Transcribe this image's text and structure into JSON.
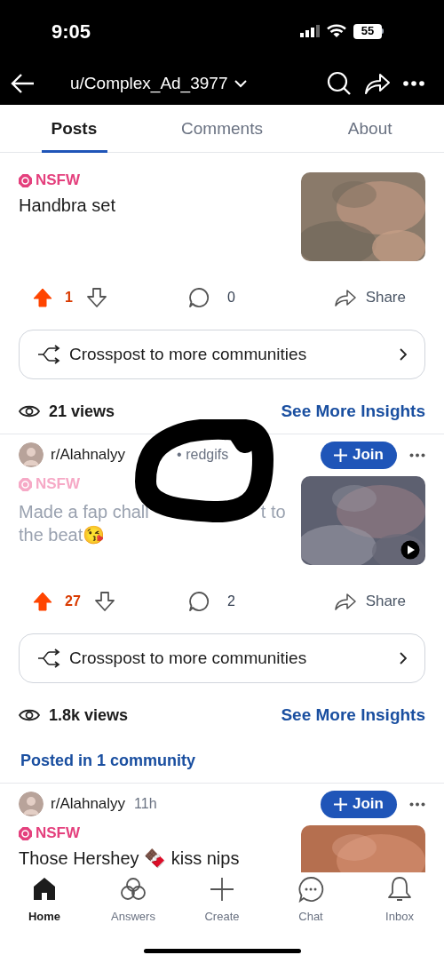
{
  "status_bar": {
    "time": "9:05",
    "battery": "55"
  },
  "header": {
    "title": "u/Complex_Ad_3977"
  },
  "tabs": [
    {
      "label": "Posts",
      "selected": true
    },
    {
      "label": "Comments",
      "selected": false
    },
    {
      "label": "About",
      "selected": false
    }
  ],
  "posts": [
    {
      "nsfw_label": "NSFW",
      "title": "Handbra set",
      "read": false,
      "video": false,
      "upvoted": true,
      "votes": "1",
      "comments": "0",
      "share": "Share",
      "crosspost": "Crosspost to more communities",
      "views": "21 views",
      "insights": "See More Insights"
    },
    {
      "community": "r/Alahnalyy",
      "meta": "• redgifs",
      "join": "Join",
      "nsfw_label": "NSFW",
      "title_parts": [
        "Made a fap chall",
        "t to",
        "the beat😘"
      ],
      "read": true,
      "video": true,
      "upvoted": true,
      "votes": "27",
      "comments": "2",
      "share": "Share",
      "crosspost": "Crosspost to more communities",
      "views": "1.8k views",
      "insights": "See More Insights",
      "posted_in": "Posted in 1 community"
    },
    {
      "community": "r/Alahnalyy",
      "meta": "11h",
      "join": "Join",
      "nsfw_label": "NSFW",
      "title": "Those Hershey 🍫 kiss nips",
      "read": false
    }
  ],
  "nav": [
    {
      "label": "Home",
      "selected": true
    },
    {
      "label": "Answers",
      "selected": false
    },
    {
      "label": "Create",
      "selected": false
    },
    {
      "label": "Chat",
      "selected": false
    },
    {
      "label": "Inbox",
      "selected": false
    }
  ]
}
